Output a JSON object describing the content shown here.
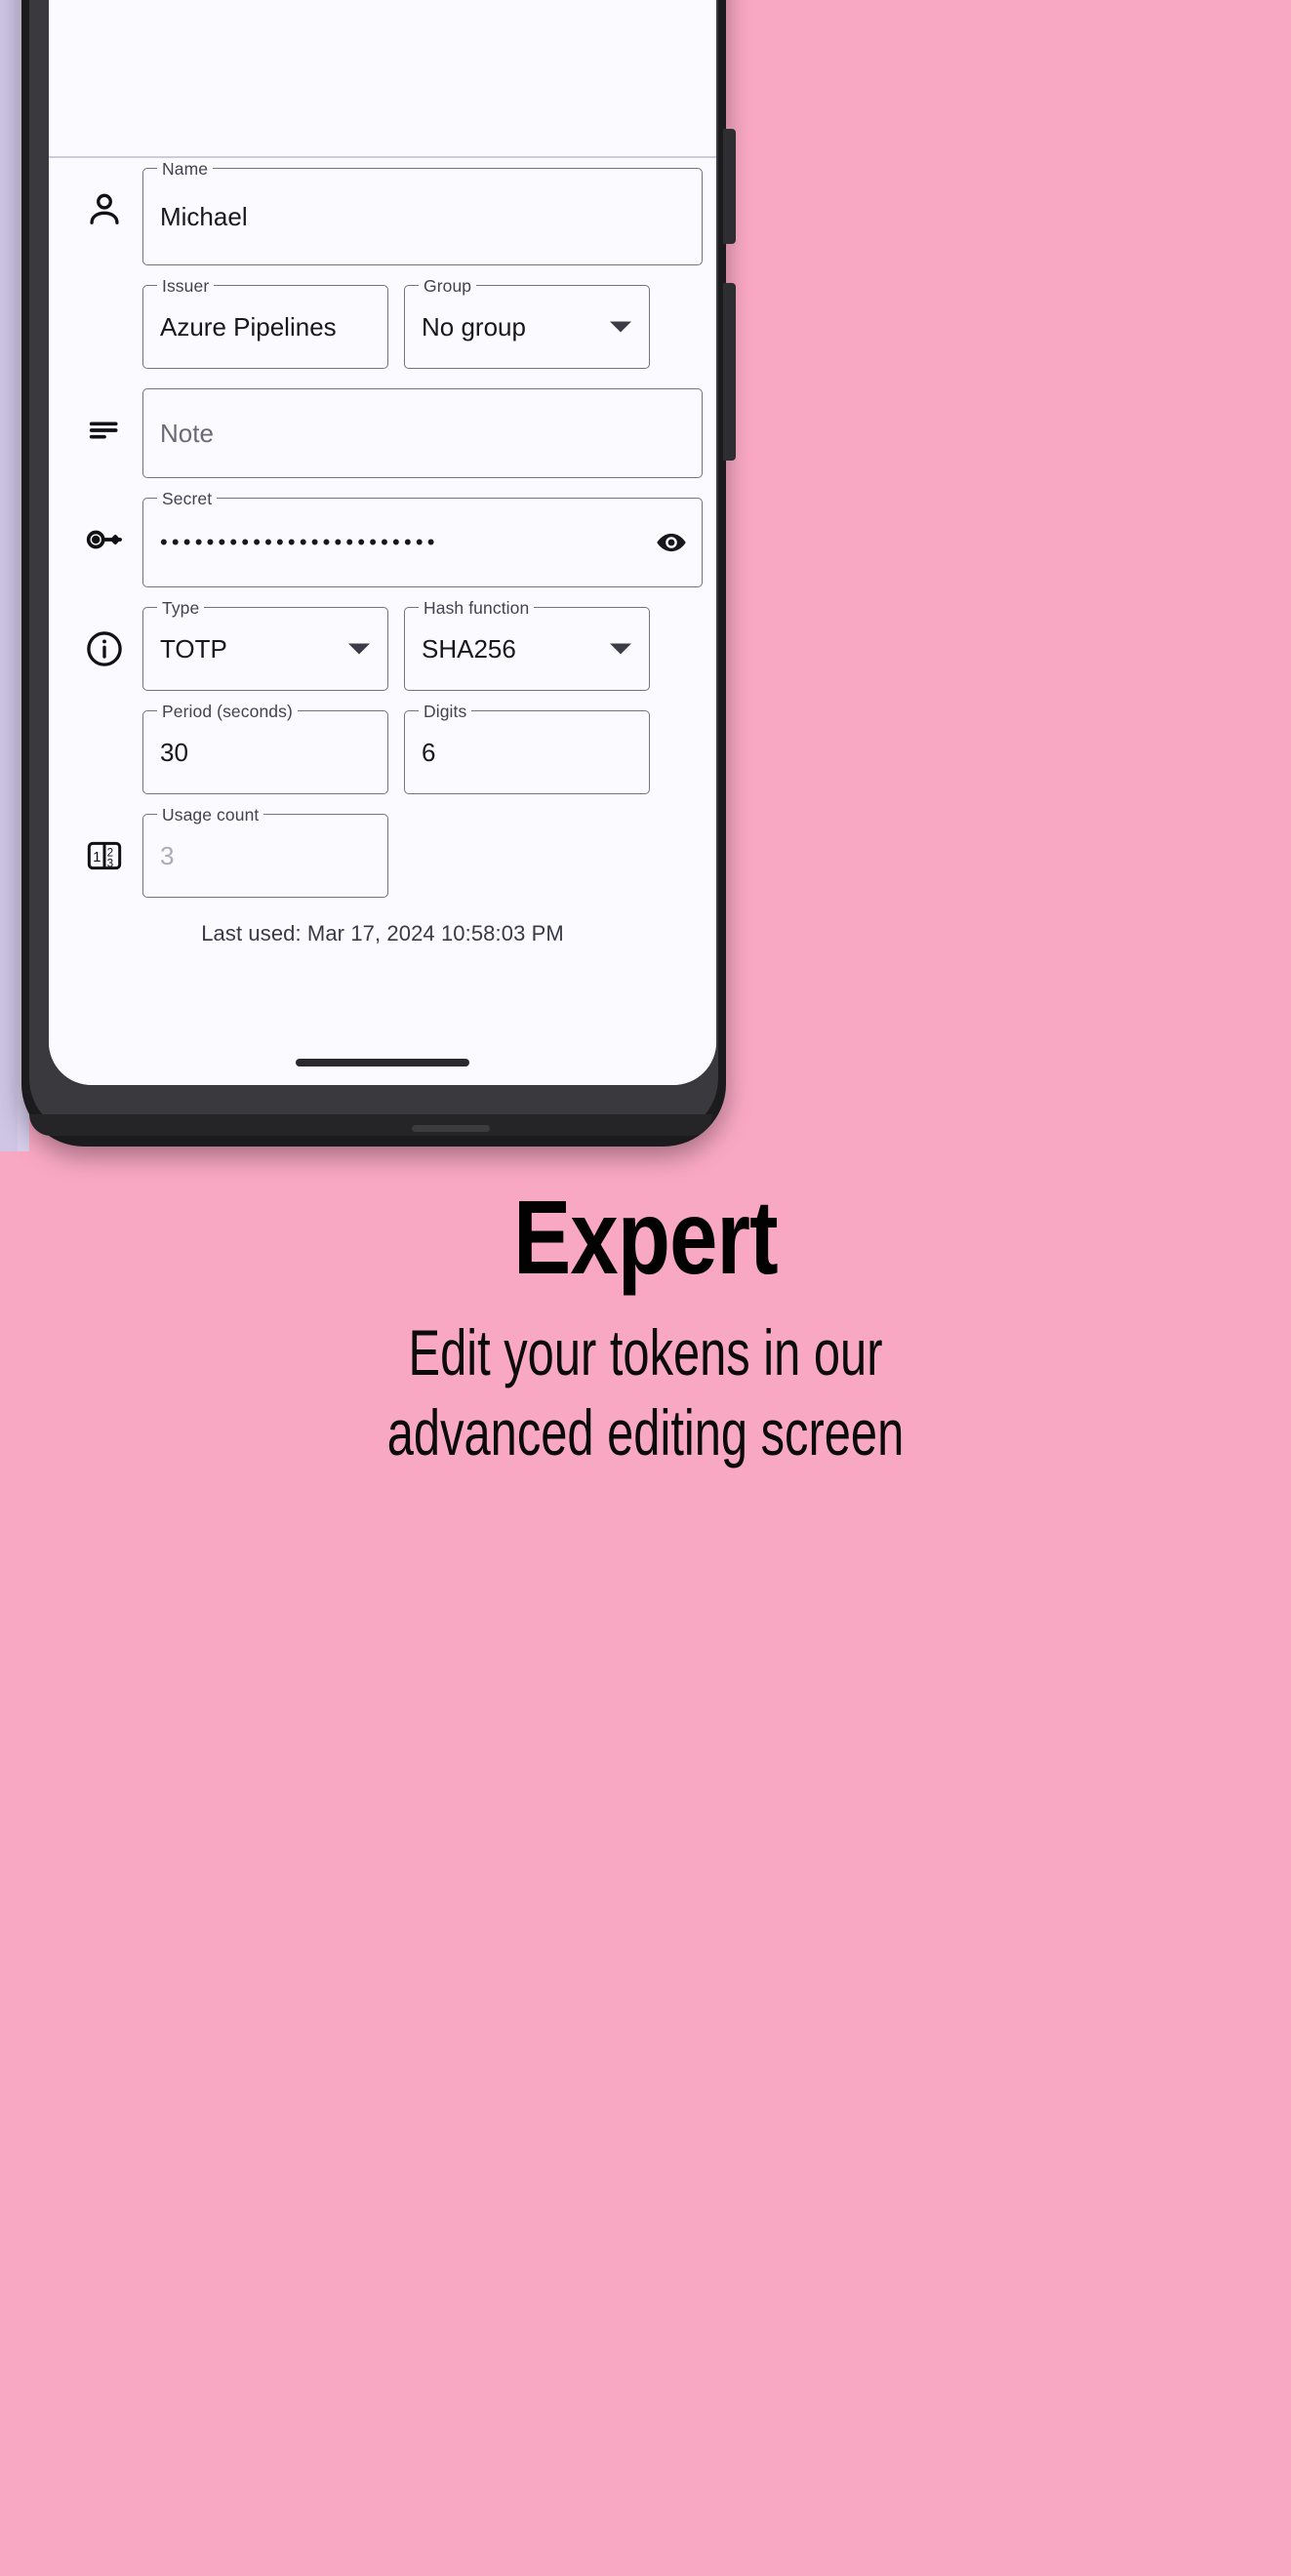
{
  "promo": {
    "title": "Expert",
    "subtitle_line1": "Edit your tokens in our",
    "subtitle_line2": "advanced editing screen"
  },
  "app": {
    "logo": "app-logo-icon",
    "accent_color": "#1f56d6",
    "background_color": "#fbfaff",
    "page_background_color": "#f9a8c3"
  },
  "form": {
    "rows": [
      {
        "icon": "person-icon",
        "fields": [
          {
            "label": "Name",
            "value": "Michael",
            "type": "text"
          }
        ]
      },
      {
        "icon": "",
        "fields": [
          {
            "label": "Issuer",
            "value": "Azure Pipelines",
            "type": "text"
          },
          {
            "label": "Group",
            "value": "No group",
            "type": "select"
          }
        ]
      },
      {
        "icon": "notes-icon",
        "fields": [
          {
            "label": "",
            "value": "Note",
            "type": "text",
            "is_placeholder": true
          }
        ]
      },
      {
        "icon": "key-icon",
        "fields": [
          {
            "label": "Secret",
            "value": "••••••••••••••••••••••••",
            "type": "password",
            "trailing_icon": "eye-icon"
          }
        ]
      },
      {
        "icon": "info-icon",
        "fields": [
          {
            "label": "Type",
            "value": "TOTP",
            "type": "select"
          },
          {
            "label": "Hash function",
            "value": "SHA256",
            "type": "select"
          }
        ]
      },
      {
        "icon": "",
        "fields": [
          {
            "label": "Period (seconds)",
            "value": "30",
            "type": "number"
          },
          {
            "label": "Digits",
            "value": "6",
            "type": "number"
          }
        ]
      },
      {
        "icon": "counter-icon",
        "fields": [
          {
            "label": "Usage count",
            "value": "3",
            "type": "number",
            "disabled": true
          }
        ]
      }
    ],
    "last_used": "Last used: Mar 17, 2024 10:58:03 PM"
  }
}
